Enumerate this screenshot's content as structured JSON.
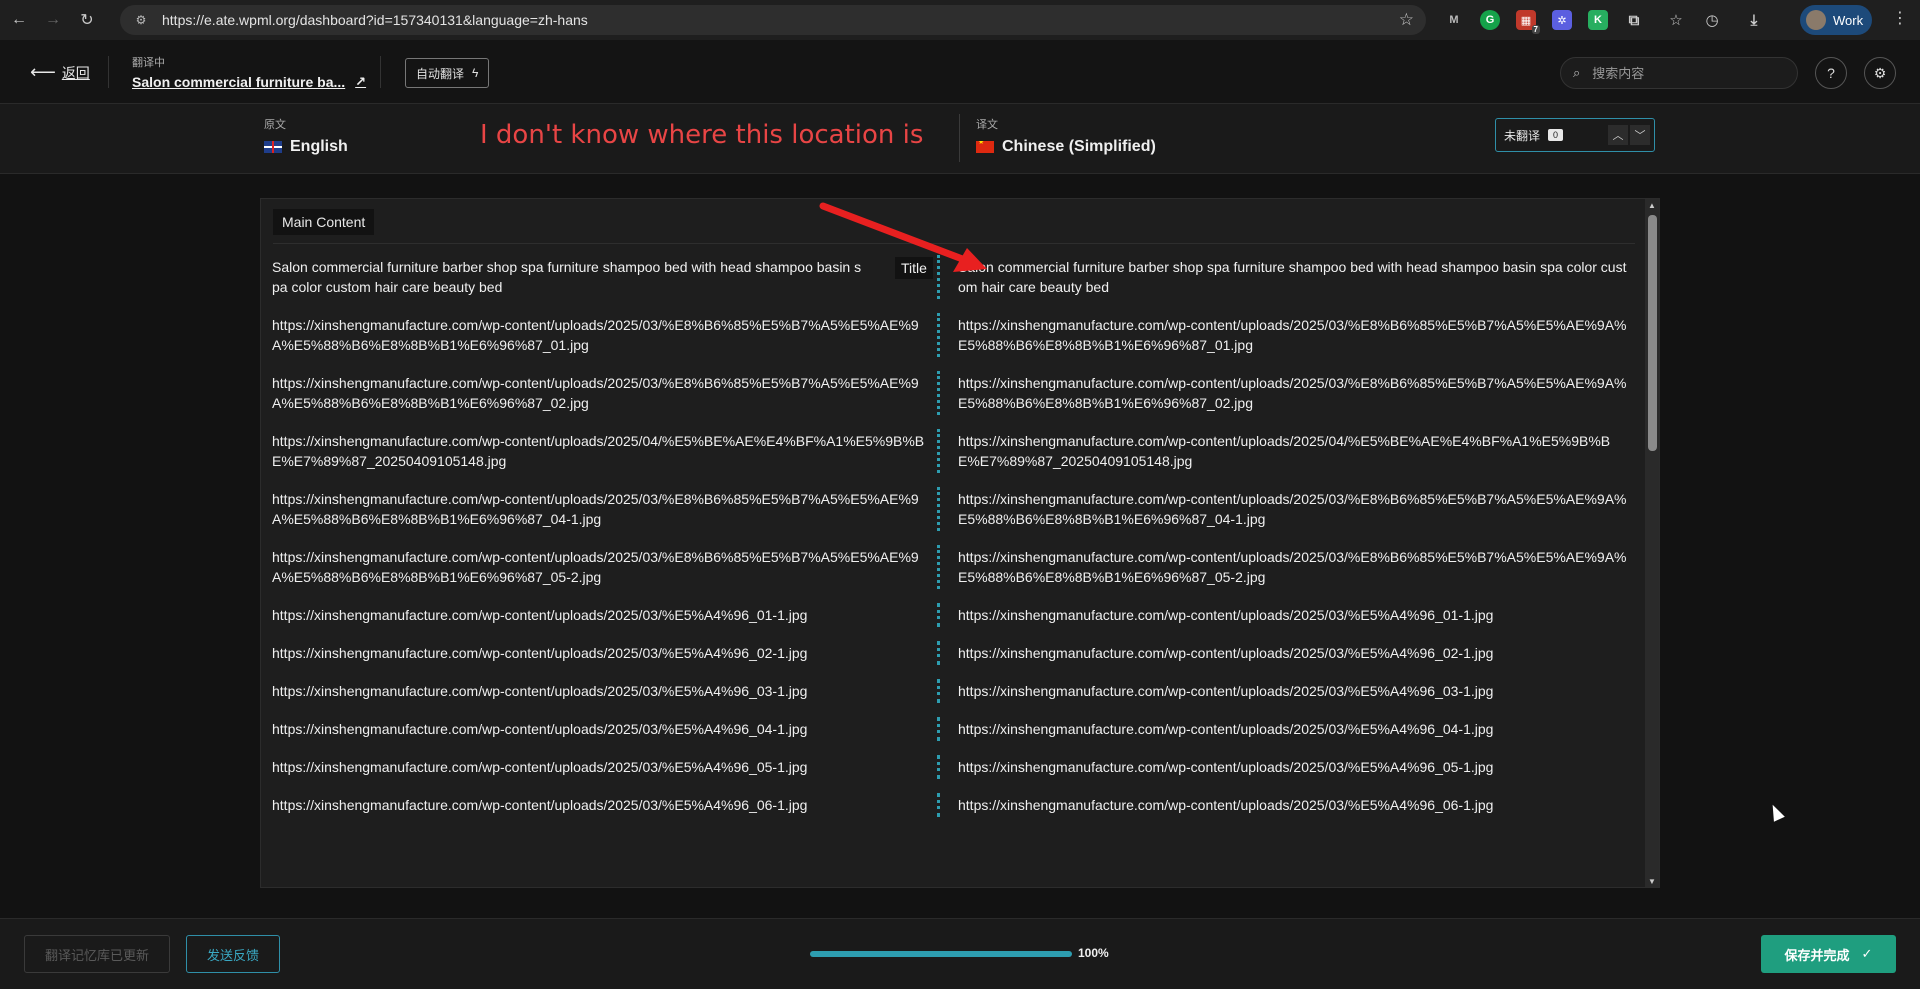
{
  "browser": {
    "url": "https://e.ate.wpml.org/dashboard?id=157340131&language=zh-hans",
    "profile_name": "Work",
    "ext_badge": "7",
    "ext_k_label": "K"
  },
  "header": {
    "back_label": "返回",
    "status_label": "翻译中",
    "job_title": "Salon commercial furniture ba...",
    "auto_translate_label": "自动翻译",
    "search_placeholder": "搜索内容"
  },
  "languages": {
    "source_label": "原文",
    "source_lang": "English",
    "target_label": "译文",
    "target_lang": "Chinese (Simplified)",
    "annotation": "I don't know where this location is",
    "filter_label": "未翻译",
    "filter_count": "0"
  },
  "editor": {
    "section_label": "Main Content",
    "title_tag": "Title",
    "rows": [
      {
        "src": "Salon commercial furniture barber shop spa furniture shampoo bed with head shampoo basin spa color custom hair care beauty bed",
        "tgt": "Salon commercial furniture barber shop spa furniture shampoo bed with head shampoo basin spa color custom hair care beauty bed"
      },
      {
        "src": "https://xinshengmanufacture.com/wp-content/uploads/2025/03/%E8%B6%85%E5%B7%A5%E5%AE%9A%E5%88%B6%E8%8B%B1%E6%96%87_01.jpg",
        "tgt": "https://xinshengmanufacture.com/wp-content/uploads/2025/03/%E8%B6%85%E5%B7%A5%E5%AE%9A%E5%88%B6%E8%8B%B1%E6%96%87_01.jpg"
      },
      {
        "src": "https://xinshengmanufacture.com/wp-content/uploads/2025/03/%E8%B6%85%E5%B7%A5%E5%AE%9A%E5%88%B6%E8%8B%B1%E6%96%87_02.jpg",
        "tgt": "https://xinshengmanufacture.com/wp-content/uploads/2025/03/%E8%B6%85%E5%B7%A5%E5%AE%9A%E5%88%B6%E8%8B%B1%E6%96%87_02.jpg"
      },
      {
        "src": "https://xinshengmanufacture.com/wp-content/uploads/2025/04/%E5%BE%AE%E4%BF%A1%E5%9B%BE%E7%89%87_20250409105148.jpg",
        "tgt": "https://xinshengmanufacture.com/wp-content/uploads/2025/04/%E5%BE%AE%E4%BF%A1%E5%9B%BE%E7%89%87_20250409105148.jpg"
      },
      {
        "src": "https://xinshengmanufacture.com/wp-content/uploads/2025/03/%E8%B6%85%E5%B7%A5%E5%AE%9A%E5%88%B6%E8%8B%B1%E6%96%87_04-1.jpg",
        "tgt": "https://xinshengmanufacture.com/wp-content/uploads/2025/03/%E8%B6%85%E5%B7%A5%E5%AE%9A%E5%88%B6%E8%8B%B1%E6%96%87_04-1.jpg"
      },
      {
        "src": "https://xinshengmanufacture.com/wp-content/uploads/2025/03/%E8%B6%85%E5%B7%A5%E5%AE%9A%E5%88%B6%E8%8B%B1%E6%96%87_05-2.jpg",
        "tgt": "https://xinshengmanufacture.com/wp-content/uploads/2025/03/%E8%B6%85%E5%B7%A5%E5%AE%9A%E5%88%B6%E8%8B%B1%E6%96%87_05-2.jpg"
      },
      {
        "src": "https://xinshengmanufacture.com/wp-content/uploads/2025/03/%E5%A4%96_01-1.jpg",
        "tgt": "https://xinshengmanufacture.com/wp-content/uploads/2025/03/%E5%A4%96_01-1.jpg"
      },
      {
        "src": "https://xinshengmanufacture.com/wp-content/uploads/2025/03/%E5%A4%96_02-1.jpg",
        "tgt": "https://xinshengmanufacture.com/wp-content/uploads/2025/03/%E5%A4%96_02-1.jpg"
      },
      {
        "src": "https://xinshengmanufacture.com/wp-content/uploads/2025/03/%E5%A4%96_03-1.jpg",
        "tgt": "https://xinshengmanufacture.com/wp-content/uploads/2025/03/%E5%A4%96_03-1.jpg"
      },
      {
        "src": "https://xinshengmanufacture.com/wp-content/uploads/2025/03/%E5%A4%96_04-1.jpg",
        "tgt": "https://xinshengmanufacture.com/wp-content/uploads/2025/03/%E5%A4%96_04-1.jpg"
      },
      {
        "src": "https://xinshengmanufacture.com/wp-content/uploads/2025/03/%E5%A4%96_05-1.jpg",
        "tgt": "https://xinshengmanufacture.com/wp-content/uploads/2025/03/%E5%A4%96_05-1.jpg"
      },
      {
        "src": "https://xinshengmanufacture.com/wp-content/uploads/2025/03/%E5%A4%96_06-1.jpg",
        "tgt": "https://xinshengmanufacture.com/wp-content/uploads/2025/03/%E5%A4%96_06-1.jpg"
      }
    ]
  },
  "footer": {
    "memory_label": "翻译记忆库已更新",
    "feedback_label": "发送反馈",
    "progress_value": 100,
    "progress_text": "100%",
    "complete_label": "保存并完成"
  },
  "colors": {
    "accent": "#2d9db0",
    "success": "#1f9e7f",
    "annotation": "#e84545"
  }
}
